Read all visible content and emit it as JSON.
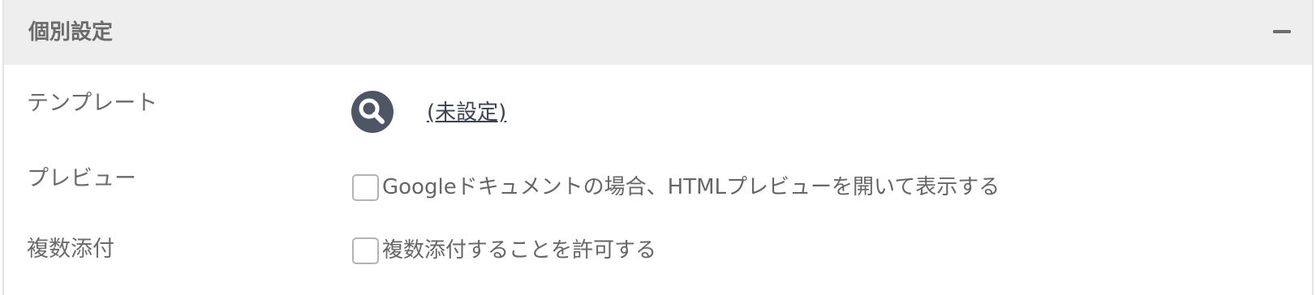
{
  "panel": {
    "title": "個別設定",
    "collapse_icon": "minus-icon"
  },
  "template": {
    "label": "テンプレート",
    "search_icon": "search-icon",
    "value_link": "(未設定)"
  },
  "preview": {
    "label": "プレビュー",
    "checkbox_label": "Googleドキュメントの場合、HTMLプレビューを開いて表示する",
    "checked": false
  },
  "multi_attach": {
    "label": "複数添付",
    "checkbox_label": "複数添付することを許可する",
    "checked": false
  },
  "colors": {
    "header_bg": "#eeeeee",
    "search_button": "#4e5666",
    "text": "#6b6b6b"
  }
}
